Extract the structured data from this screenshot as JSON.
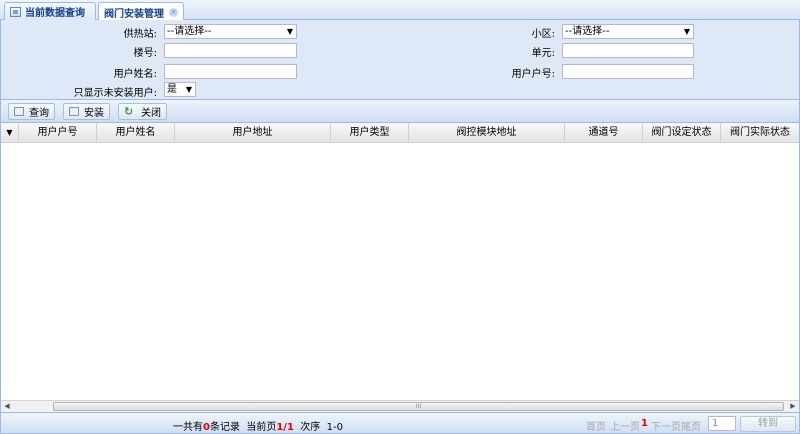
{
  "tabs": [
    {
      "label": "当前数据查询",
      "active": false
    },
    {
      "label": "阀门安装管理",
      "active": true,
      "close": "×"
    }
  ],
  "form": {
    "heating_station": {
      "label": "供热站:",
      "value": "--请选择--"
    },
    "community": {
      "label": "小区:",
      "value": "--请选择--"
    },
    "building": {
      "label": "楼号:",
      "value": ""
    },
    "unit": {
      "label": "单元:",
      "value": ""
    },
    "user_name": {
      "label": "用户姓名:",
      "value": ""
    },
    "user_account": {
      "label": "用户户号:",
      "value": ""
    },
    "uninstalled_only": {
      "label": "只显示未安装用户:",
      "value": "是"
    }
  },
  "toolbar": {
    "query": "查询",
    "install": "安装",
    "close": "关闭"
  },
  "grid": {
    "columns": [
      "用户户号",
      "用户姓名",
      "用户地址",
      "用户类型",
      "阀控模块地址",
      "通道号",
      "阀门设定状态",
      "阀门实际状态"
    ],
    "rows": [],
    "scroll_grip": "III"
  },
  "pager": {
    "total_prefix": "一共有",
    "total": "0",
    "total_suffix": "条记录",
    "page_prefix": "当前页",
    "page": "1/1",
    "order_prefix": "次序",
    "order": "1-0",
    "first": "首页",
    "prev": "上一页",
    "current": "1",
    "next": "下一页",
    "last": "尾页",
    "goto_value": "1",
    "goto_label": "转到"
  },
  "colors": {
    "panel_bg": "#dfe8f6",
    "border": "#99bbe8",
    "tab_text": "#15428b",
    "highlight": "#e00000"
  }
}
